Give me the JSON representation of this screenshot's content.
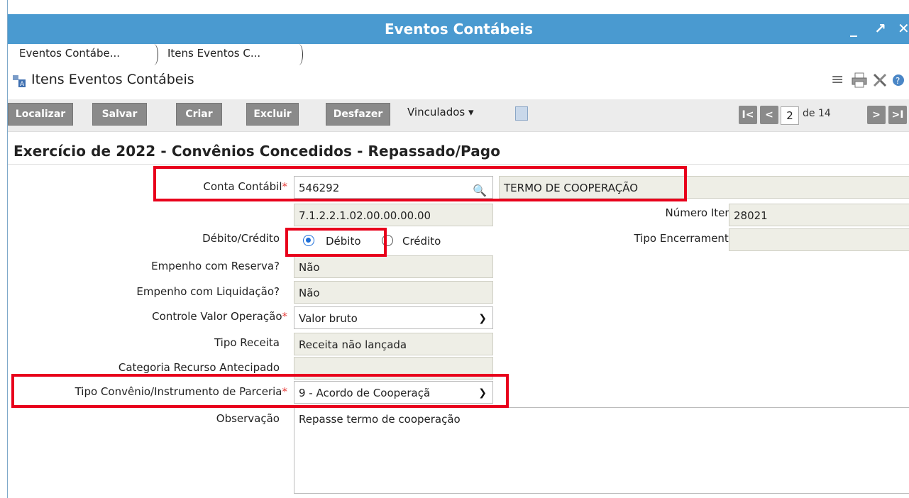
{
  "window": {
    "title": "Eventos Contábeis",
    "minimize": "_",
    "maximize": "↗",
    "close": "✕"
  },
  "breadcrumbs": [
    "Eventos Contábe...",
    "Itens Eventos C..."
  ],
  "page": {
    "heading": "Itens Eventos Contábeis"
  },
  "toolbar": {
    "localizar": "Localizar",
    "salvar": "Salvar",
    "criar": "Criar",
    "excluir": "Excluir",
    "desfazer": "Desfazer",
    "vinculados": "Vinculados ▾"
  },
  "pager": {
    "first": "I<",
    "prev": "<",
    "current": "2",
    "of_label": "de 14",
    "next": ">",
    "last": ">I"
  },
  "section": {
    "title": "Exercício de 2022 - Convênios Concedidos - Repassado/Pago"
  },
  "form": {
    "conta_contabil_label": "Conta Contábil",
    "conta_contabil_value": "546292",
    "conta_contabil_desc": "TERMO DE COOPERAÇÃO",
    "conta_contabil_code": "7.1.2.2.1.02.00.00.00.00",
    "numero_item_label": "Número Item",
    "numero_item_value": "28021",
    "debito_credito_label": "Débito/Crédito",
    "debito_label": "Débito",
    "credito_label": "Crédito",
    "debito_selected": true,
    "tipo_encerramento_label": "Tipo Encerramento",
    "tipo_encerramento_value": "",
    "empenho_reserva_label": "Empenho com Reserva?",
    "empenho_reserva_value": "Não",
    "empenho_liquidacao_label": "Empenho com Liquidação?",
    "empenho_liquidacao_value": "Não",
    "controle_valor_label": "Controle Valor Operação",
    "controle_valor_value": "Valor bruto",
    "tipo_receita_label": "Tipo Receita",
    "tipo_receita_value": "Receita não lançada",
    "categoria_recurso_label": "Categoria Recurso Antecipado",
    "categoria_recurso_value": "",
    "tipo_convenio_label": "Tipo Convênio/Instrumento de Parceria",
    "tipo_convenio_value": "9 - Acordo de Cooperaçã",
    "observacao_label": "Observação",
    "observacao_value": "Repasse termo de cooperação",
    "required_mark": "*"
  },
  "colors": {
    "titlebar": "#4a9ad0",
    "button": "#8a8a8a",
    "highlight": "#e8001c",
    "readonly_field": "#eeeee6"
  }
}
